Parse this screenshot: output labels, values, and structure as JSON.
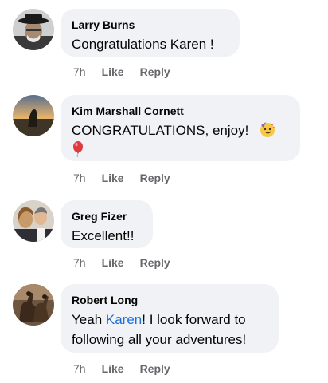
{
  "comments": [
    {
      "author": "Larry Burns",
      "text": "Congratulations Karen !",
      "time": "7h",
      "like": "Like",
      "reply": "Reply",
      "avatar_icon": "person-with-hat-avatar"
    },
    {
      "author": "Kim Marshall Cornett",
      "text": "CONGRATULATIONS, enjoy!",
      "emoji_1": "partying-face-emoji",
      "emoji_2": "balloon-emoji",
      "time": "7h",
      "like": "Like",
      "reply": "Reply",
      "avatar_icon": "sunset-dog-avatar"
    },
    {
      "author": "Greg Fizer",
      "text": "Excellent!!",
      "time": "7h",
      "like": "Like",
      "reply": "Reply",
      "avatar_icon": "couple-photo-avatar"
    },
    {
      "author": "Robert Long",
      "text_before": "Yeah ",
      "mention": "Karen",
      "text_after_line1": "! I look forward to",
      "text_line2": "following all your adventures!",
      "time": "7h",
      "like": "Like",
      "reply": "Reply",
      "avatar_icon": "horse-riders-avatar"
    }
  ],
  "colors": {
    "bubble": "#f0f2f5",
    "meta": "#65676b",
    "mention": "#1d6fd6"
  }
}
